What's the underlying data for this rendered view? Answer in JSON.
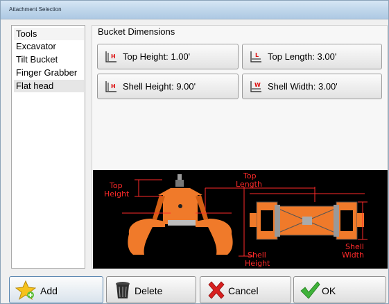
{
  "window": {
    "title": "Attachment Selection"
  },
  "tools_list": {
    "header": "Tools",
    "items": [
      {
        "label": "Excavator"
      },
      {
        "label": "Tilt Bucket"
      },
      {
        "label": "Finger Grabber"
      },
      {
        "label": "Flat head",
        "selected": true
      }
    ]
  },
  "bucket_dimensions": {
    "title": "Bucket Dimensions",
    "buttons": {
      "top_height": {
        "label": "Top Height: 1.00'",
        "icon": "height-h-icon"
      },
      "top_length": {
        "label": "Top Length: 3.00'",
        "icon": "length-l-icon"
      },
      "shell_height": {
        "label": "Shell Height: 9.00'",
        "icon": "height-h-icon"
      },
      "shell_width": {
        "label": "Shell Width: 3.00'",
        "icon": "width-w-icon"
      }
    }
  },
  "diagram": {
    "labels": {
      "top_height_1": "Top",
      "top_height_2": "Height",
      "top_length_1": "Top",
      "top_length_2": "Length",
      "shell_height_1": "Shell",
      "shell_height_2": "Height",
      "shell_width_1": "Shell",
      "shell_width_2": "Width"
    },
    "colors": {
      "part": "#f07a2a",
      "dimension": "#ff2a2a",
      "background": "#000000"
    }
  },
  "actions": {
    "add": {
      "label": "Add",
      "icon": "star-icon"
    },
    "delete": {
      "label": "Delete",
      "icon": "trash-icon"
    },
    "cancel": {
      "label": "Cancel",
      "icon": "red-x-icon"
    },
    "ok": {
      "label": "OK",
      "icon": "green-check-icon"
    }
  }
}
